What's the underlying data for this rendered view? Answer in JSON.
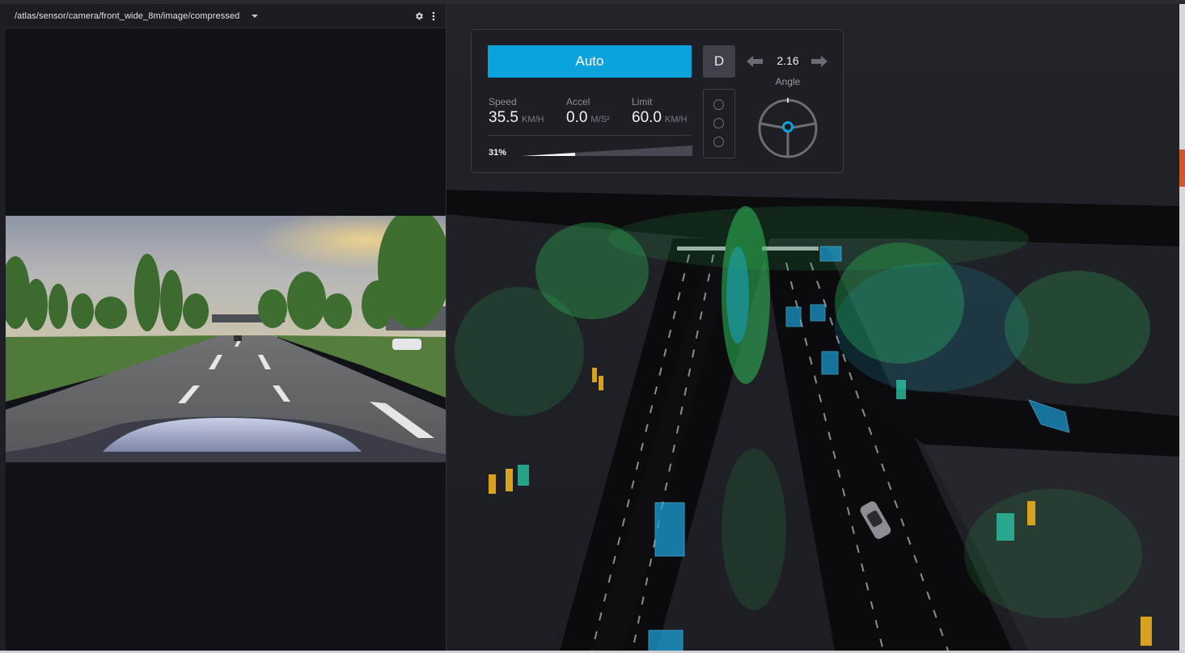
{
  "camera_panel": {
    "topic": "/atlas/sensor/camera/front_wide_8m/image/compressed",
    "icons": {
      "dropdown": "chevron-down-icon",
      "settings": "gear-icon",
      "menu": "more-vertical-icon"
    }
  },
  "hud": {
    "mode_button": "Auto",
    "gear": "D",
    "steering": {
      "value": "2.16",
      "label": "Angle",
      "icons": [
        "arrow-left-icon",
        "arrow-right-icon",
        "steering-wheel-icon"
      ]
    },
    "speed": {
      "label": "Speed",
      "value": "35.5",
      "unit": "KM/H"
    },
    "accel": {
      "label": "Accel",
      "value": "0.0",
      "unit": "M/S²"
    },
    "limit": {
      "label": "Limit",
      "value": "60.0",
      "unit": "KM/H"
    },
    "throttle": {
      "text": "31%",
      "fraction": 0.31
    },
    "traffic_lights": 3
  },
  "colors": {
    "accent": "#0aa3de",
    "panel_bg": "#111217",
    "scene_bg": "#1f2025",
    "road": "#0b0b0e",
    "lidar_green": "#2fbf5a",
    "lidar_cyan": "#1aa6c9",
    "box_blue": "#1c9fd8",
    "box_teal": "#2bc2a3",
    "cone_yellow": "#d8a21e",
    "right_edge_accent": "#d0572b"
  }
}
